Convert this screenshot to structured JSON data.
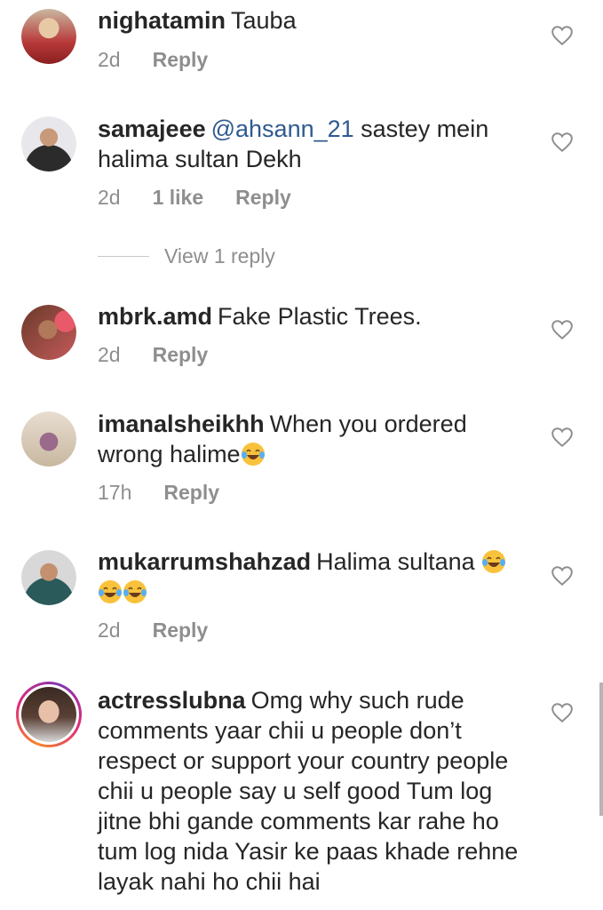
{
  "comments": [
    {
      "username": "nighatamin",
      "text": "Tauba",
      "time": "2d",
      "likes": "",
      "reply": "Reply"
    },
    {
      "username": "samajeee",
      "mention": "@ahsann_21",
      "text": " sastey mein halima sultan Dekh",
      "time": "2d",
      "likes": "1 like",
      "reply": "Reply",
      "view_replies": "View 1 reply"
    },
    {
      "username": "mbrk.amd",
      "text": "Fake Plastic Trees.",
      "time": "2d",
      "likes": "",
      "reply": "Reply"
    },
    {
      "username": "imanalsheikhh",
      "text": "When you ordered wrong halime",
      "time": "17h",
      "likes": "",
      "reply": "Reply"
    },
    {
      "username": "mukarrumshahzad",
      "text": "Halima sultana ",
      "time": "2d",
      "likes": "",
      "reply": "Reply"
    },
    {
      "username": "actresslubna",
      "text": "Omg why such rude comments yaar chii u people don’t respect or support your country people chii u people say u self good Tum log jitne bhi gande comments kar rahe ho tum log nida Yasir ke paas khade rehne layak nahi ho chii hai"
    }
  ],
  "icons": {
    "like": "heart-outline-icon",
    "emoji": "face-with-tears-of-joy-emoji"
  },
  "colors": {
    "text": "#262626",
    "secondary": "#8e8e8e",
    "mention": "#2f5a8f"
  }
}
